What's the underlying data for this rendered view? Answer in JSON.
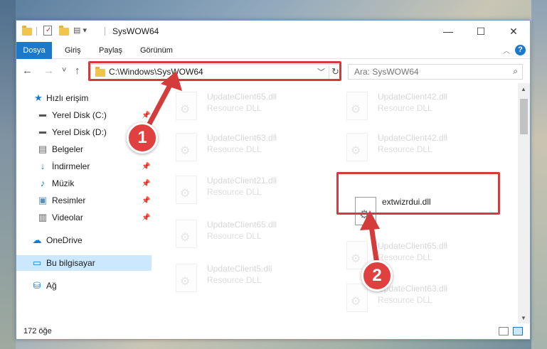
{
  "window": {
    "title": "SysWOW64",
    "controls": {
      "minimize": "—",
      "maximize": "☐",
      "close": "✕"
    }
  },
  "ribbon": {
    "tabs": [
      {
        "label": "Dosya",
        "active": true
      },
      {
        "label": "Giriş"
      },
      {
        "label": "Paylaş"
      },
      {
        "label": "Görünüm"
      }
    ],
    "help": "?"
  },
  "nav": {
    "back": "←",
    "forward": "→",
    "recent": "˅",
    "up": "↑",
    "address": "C:\\Windows\\SysWOW64",
    "search_placeholder": "Ara: SysWOW64"
  },
  "sidebar": {
    "items": [
      {
        "label": "Hızlı erişim",
        "icon": "star-icon"
      },
      {
        "label": "Yerel Disk (C:)",
        "icon": "drive-icon",
        "pinned": true
      },
      {
        "label": "Yerel Disk (D:)",
        "icon": "drive-icon",
        "pinned": true
      },
      {
        "label": "Belgeler",
        "icon": "documents-icon",
        "pinned": true
      },
      {
        "label": "İndirmeler",
        "icon": "download-icon",
        "pinned": true
      },
      {
        "label": "Müzik",
        "icon": "music-icon",
        "pinned": true
      },
      {
        "label": "Resimler",
        "icon": "pictures-icon",
        "pinned": true
      },
      {
        "label": "Videolar",
        "icon": "videos-icon",
        "pinned": true
      },
      {
        "label": "OneDrive",
        "icon": "cloud-icon"
      },
      {
        "label": "Bu bilgisayar",
        "icon": "computer-icon",
        "selected": true
      },
      {
        "label": "Ağ",
        "icon": "network-icon"
      }
    ]
  },
  "files": {
    "left": [
      {
        "name": "UpdateClient65.dll",
        "type": "Resource DLL"
      },
      {
        "name": "UpdateClient63.dll",
        "type": "Resource DLL"
      },
      {
        "name": "UpdateClient21.dll",
        "type": "Resource DLL"
      },
      {
        "name": "UpdateClient65.dll",
        "type": "Resource DLL"
      },
      {
        "name": "UpdateClient5.dll",
        "type": "Resource DLL"
      }
    ],
    "right": [
      {
        "name": "UpdateClient42.dll",
        "type": "Resource DLL"
      },
      {
        "name": "UpdateClient42.dll",
        "type": "Resource DLL"
      },
      {
        "name": "extwizrdui.dll",
        "type": "",
        "highlighted": true
      },
      {
        "name": "UpdateClient65.dll",
        "type": "Resource DLL"
      },
      {
        "name": "UpdateClient63.dll",
        "type": "Resource DLL"
      }
    ]
  },
  "status": {
    "item_count": "172 öğe"
  },
  "annotations": {
    "step1": "1",
    "step2": "2",
    "color": "#d43c3c"
  }
}
